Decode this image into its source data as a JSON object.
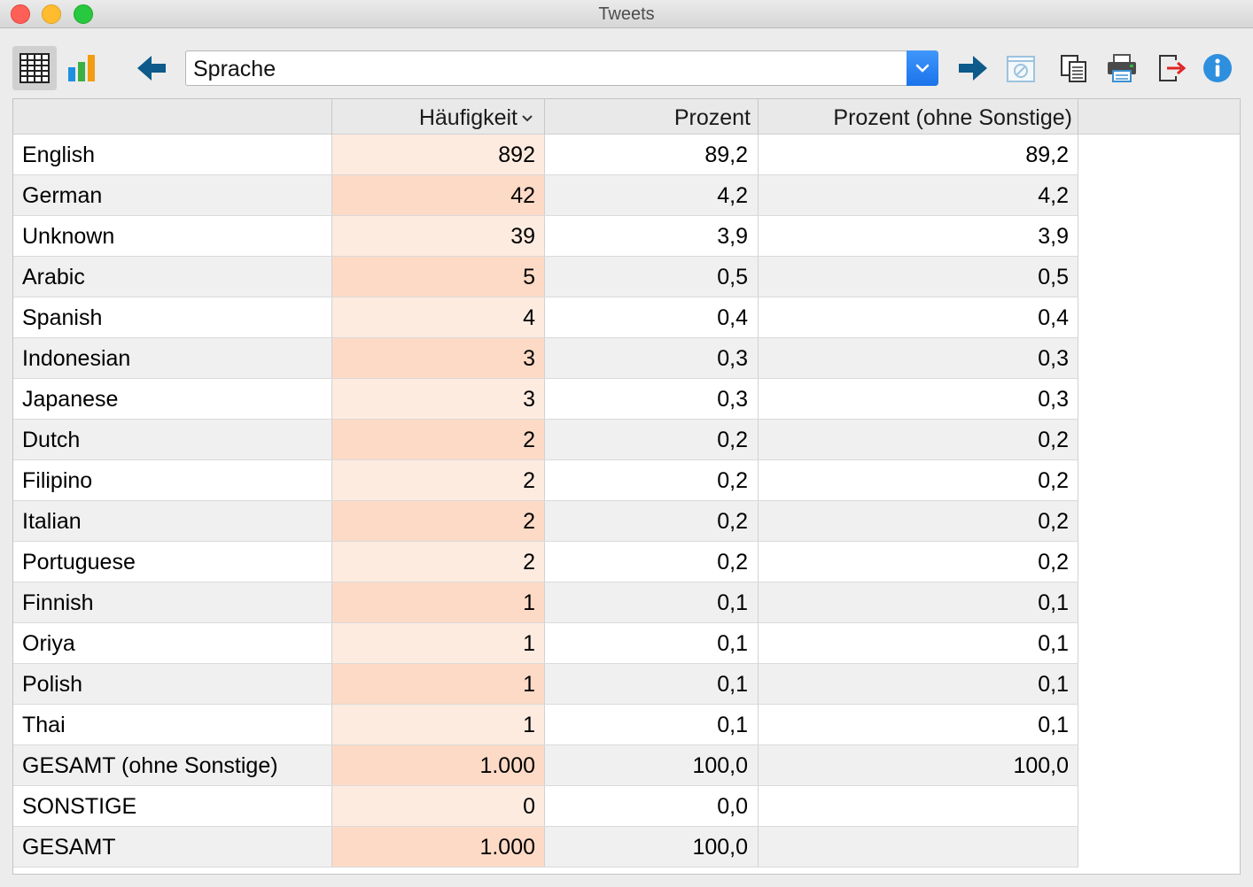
{
  "window": {
    "title": "Tweets"
  },
  "toolbar": {
    "variable_select": {
      "selected": "Sprache"
    },
    "icons": [
      "table-view-icon",
      "chart-view-icon",
      "arrow-left-icon",
      "chevron-down-icon",
      "arrow-right-icon",
      "filter-off-icon",
      "copy-icon",
      "print-icon",
      "export-icon",
      "info-icon"
    ]
  },
  "table": {
    "columns": [
      "",
      "Häufigkeit",
      "Prozent",
      "Prozent (ohne Sonstige)"
    ],
    "sorted_column": "Häufigkeit",
    "rows": [
      {
        "label": "English",
        "freq": "892",
        "pct": "89,2",
        "pct_excl": "89,2"
      },
      {
        "label": "German",
        "freq": "42",
        "pct": "4,2",
        "pct_excl": "4,2"
      },
      {
        "label": "Unknown",
        "freq": "39",
        "pct": "3,9",
        "pct_excl": "3,9"
      },
      {
        "label": "Arabic",
        "freq": "5",
        "pct": "0,5",
        "pct_excl": "0,5"
      },
      {
        "label": "Spanish",
        "freq": "4",
        "pct": "0,4",
        "pct_excl": "0,4"
      },
      {
        "label": "Indonesian",
        "freq": "3",
        "pct": "0,3",
        "pct_excl": "0,3"
      },
      {
        "label": "Japanese",
        "freq": "3",
        "pct": "0,3",
        "pct_excl": "0,3"
      },
      {
        "label": "Dutch",
        "freq": "2",
        "pct": "0,2",
        "pct_excl": "0,2"
      },
      {
        "label": "Filipino",
        "freq": "2",
        "pct": "0,2",
        "pct_excl": "0,2"
      },
      {
        "label": "Italian",
        "freq": "2",
        "pct": "0,2",
        "pct_excl": "0,2"
      },
      {
        "label": "Portuguese",
        "freq": "2",
        "pct": "0,2",
        "pct_excl": "0,2"
      },
      {
        "label": "Finnish",
        "freq": "1",
        "pct": "0,1",
        "pct_excl": "0,1"
      },
      {
        "label": "Oriya",
        "freq": "1",
        "pct": "0,1",
        "pct_excl": "0,1"
      },
      {
        "label": "Polish",
        "freq": "1",
        "pct": "0,1",
        "pct_excl": "0,1"
      },
      {
        "label": "Thai",
        "freq": "1",
        "pct": "0,1",
        "pct_excl": "0,1"
      },
      {
        "label": "GESAMT (ohne Sonstige)",
        "freq": "1.000",
        "pct": "100,0",
        "pct_excl": "100,0"
      },
      {
        "label": "SONSTIGE",
        "freq": "0",
        "pct": "0,0",
        "pct_excl": ""
      },
      {
        "label": "GESAMT",
        "freq": "1.000",
        "pct": "100,0",
        "pct_excl": ""
      }
    ]
  },
  "colors": {
    "freq_highlight_light": "#fdebe0",
    "freq_highlight_dark": "#fddac6",
    "accent_blue": "#1a73ea",
    "arrow_navy": "#0e5a8a"
  }
}
